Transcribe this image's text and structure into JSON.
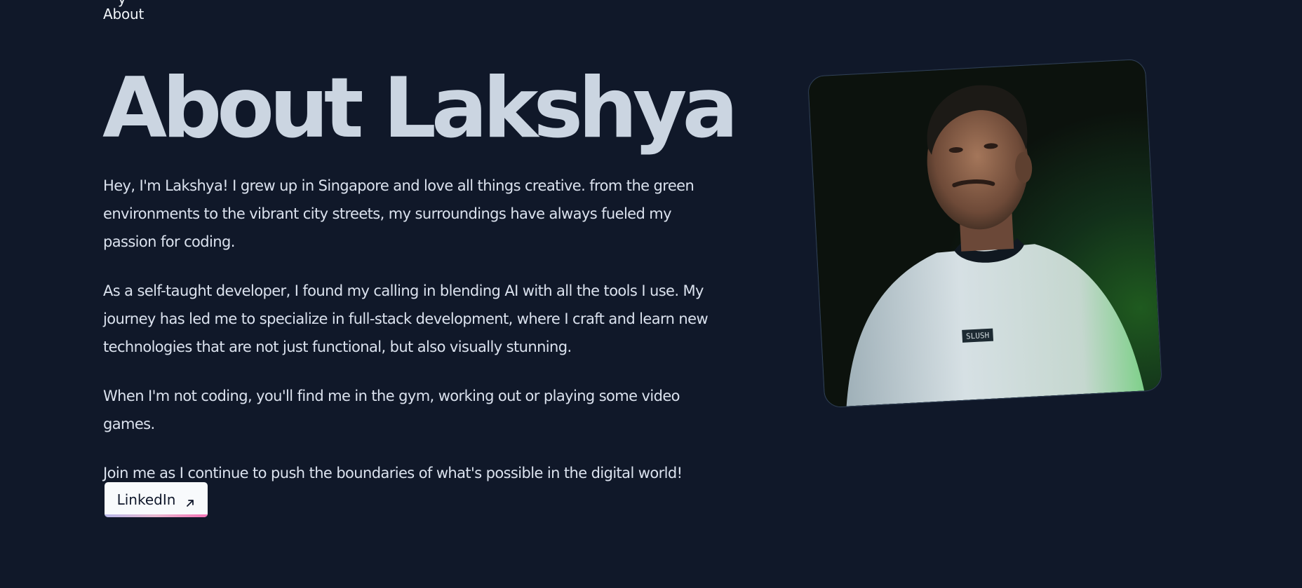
{
  "nav": {
    "prev_label": "y",
    "about_label": "About"
  },
  "header": {
    "title": "About Lakshya"
  },
  "bio": {
    "paragraphs": [
      "Hey, I'm Lakshya! I grew up in Singapore and love all things creative. from the green environments to the vibrant city streets, my surroundings have always fueled my passion for coding.",
      "As a self-taught developer, I found my calling in blending AI with all the tools I use. My journey has led me to specialize in full-stack development, where I craft and learn new technologies that are not just functional, but also visually stunning.",
      "When I'm not coding, you'll find me in the gym, working out or playing some video games.",
      "Join me as I continue to push the boundaries of what's possible in the digital world!"
    ]
  },
  "cta": {
    "linkedin_label": "LinkedIn",
    "icon": "arrow-up-right-icon"
  },
  "portrait": {
    "shirt_text": "SLUSH"
  },
  "colors": {
    "background": "#101829",
    "title": "#cbd5e1",
    "text": "#dbe2ee",
    "button_bg": "#f8fafc",
    "button_text": "#0f172a"
  }
}
